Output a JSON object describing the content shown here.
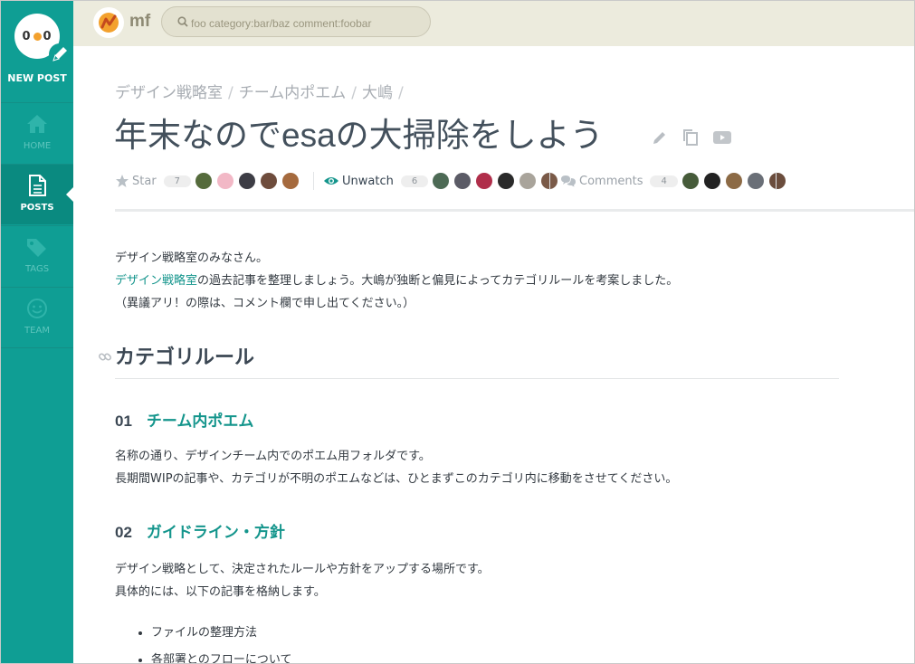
{
  "sidebar": {
    "new_post_label": "NEW POST",
    "items": [
      {
        "label": "HOME",
        "icon": "home-icon"
      },
      {
        "label": "POSTS",
        "icon": "document-icon"
      },
      {
        "label": "TAGS",
        "icon": "tags-icon"
      },
      {
        "label": "TEAM",
        "icon": "smiley-icon"
      }
    ],
    "colors": {
      "bg": "#0f9e94",
      "active_bg": "#0a8a80"
    }
  },
  "topbar": {
    "team_name": "mf",
    "search_placeholder": "foo category:bar/baz comment:foobar"
  },
  "post": {
    "breadcrumb": [
      "デザイン戦略室",
      "チーム内ポエム",
      "大嶋"
    ],
    "breadcrumb_trailing": "/",
    "title": "年末なのでesaの大掃除をしよう",
    "actions": {
      "star_label": "Star",
      "star_count": "7",
      "watch_label": "Unwatch",
      "watch_count": "6",
      "comments_label": "Comments",
      "comments_count": "4"
    },
    "intro_line1": "デザイン戦略室のみなさん。",
    "intro_link": "デザイン戦略室",
    "intro_line2_rest": "の過去記事を整理しましょう。大嶋が独断と偏見によってカテゴリルールを考案しました。",
    "intro_line3": "（異議アリ！の際は、コメント欄で申し出てください。）",
    "h1": "カテゴリルール",
    "sections": [
      {
        "num": "01",
        "title": "チーム内ポエム",
        "lines": [
          "名称の通り、デザインチーム内でのポエム用フォルダです。",
          "長期間WIPの記事や、カテゴリが不明のポエムなどは、ひとまずこのカテゴリ内に移動をさせてください。"
        ]
      },
      {
        "num": "02",
        "title": "ガイドライン・方針",
        "lines": [
          "デザイン戦略として、決定されたルールや方針をアップする場所です。",
          "具体的には、以下の記事を格納します。"
        ]
      }
    ],
    "list": [
      "ファイルの整理方法",
      "各部署とのフローについて"
    ],
    "accent": "#14958c"
  }
}
